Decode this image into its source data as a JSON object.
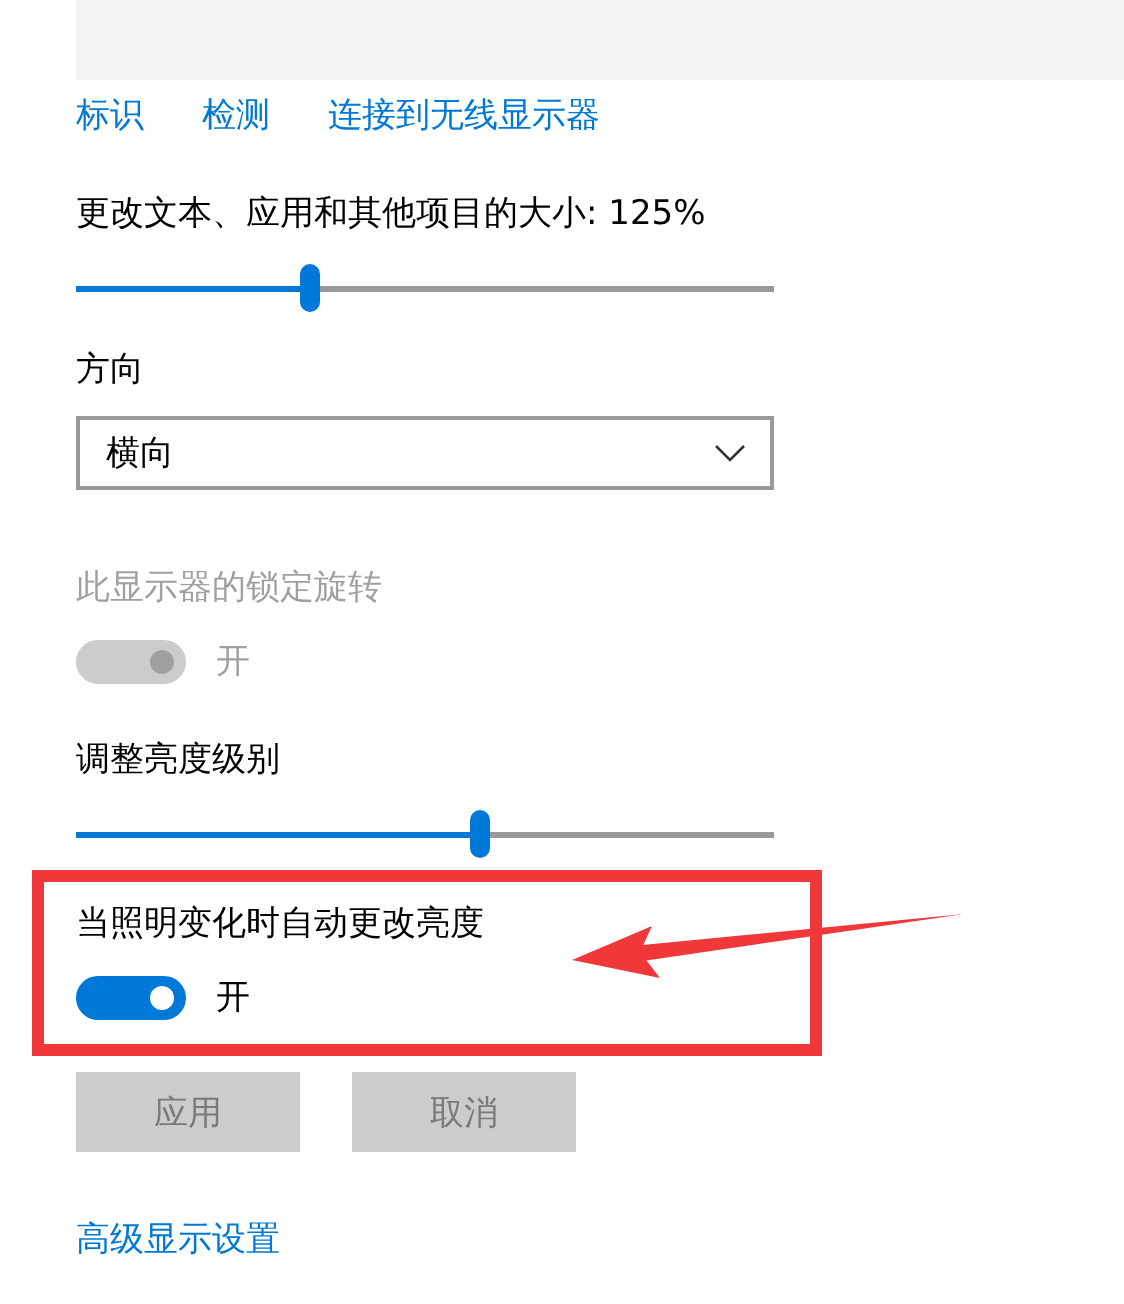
{
  "links": [
    {
      "label": "标识"
    },
    {
      "label": "检测"
    },
    {
      "label": "连接到无线显示器"
    }
  ],
  "settings": [
    {
      "kind": "slider",
      "label": "更改文本、应用和其他项目的大小: 125%",
      "level": 0.335
    },
    {
      "kind": "dropdown",
      "label": "方向",
      "value": "横向"
    },
    {
      "kind": "toggle",
      "label": "此显示器的锁定旋转",
      "on": true,
      "state_text": "开",
      "disabled": true,
      "highlighted": false
    },
    {
      "kind": "slider",
      "label": "调整亮度级别",
      "level": 0.58
    },
    {
      "kind": "toggle",
      "label": "当照明变化时自动更改亮度",
      "on": true,
      "state_text": "开",
      "disabled": false,
      "highlighted": true
    }
  ],
  "buttons": [
    {
      "label": "应用",
      "disabled": true
    },
    {
      "label": "取消",
      "disabled": true
    }
  ],
  "footer_link": "高级显示设置"
}
